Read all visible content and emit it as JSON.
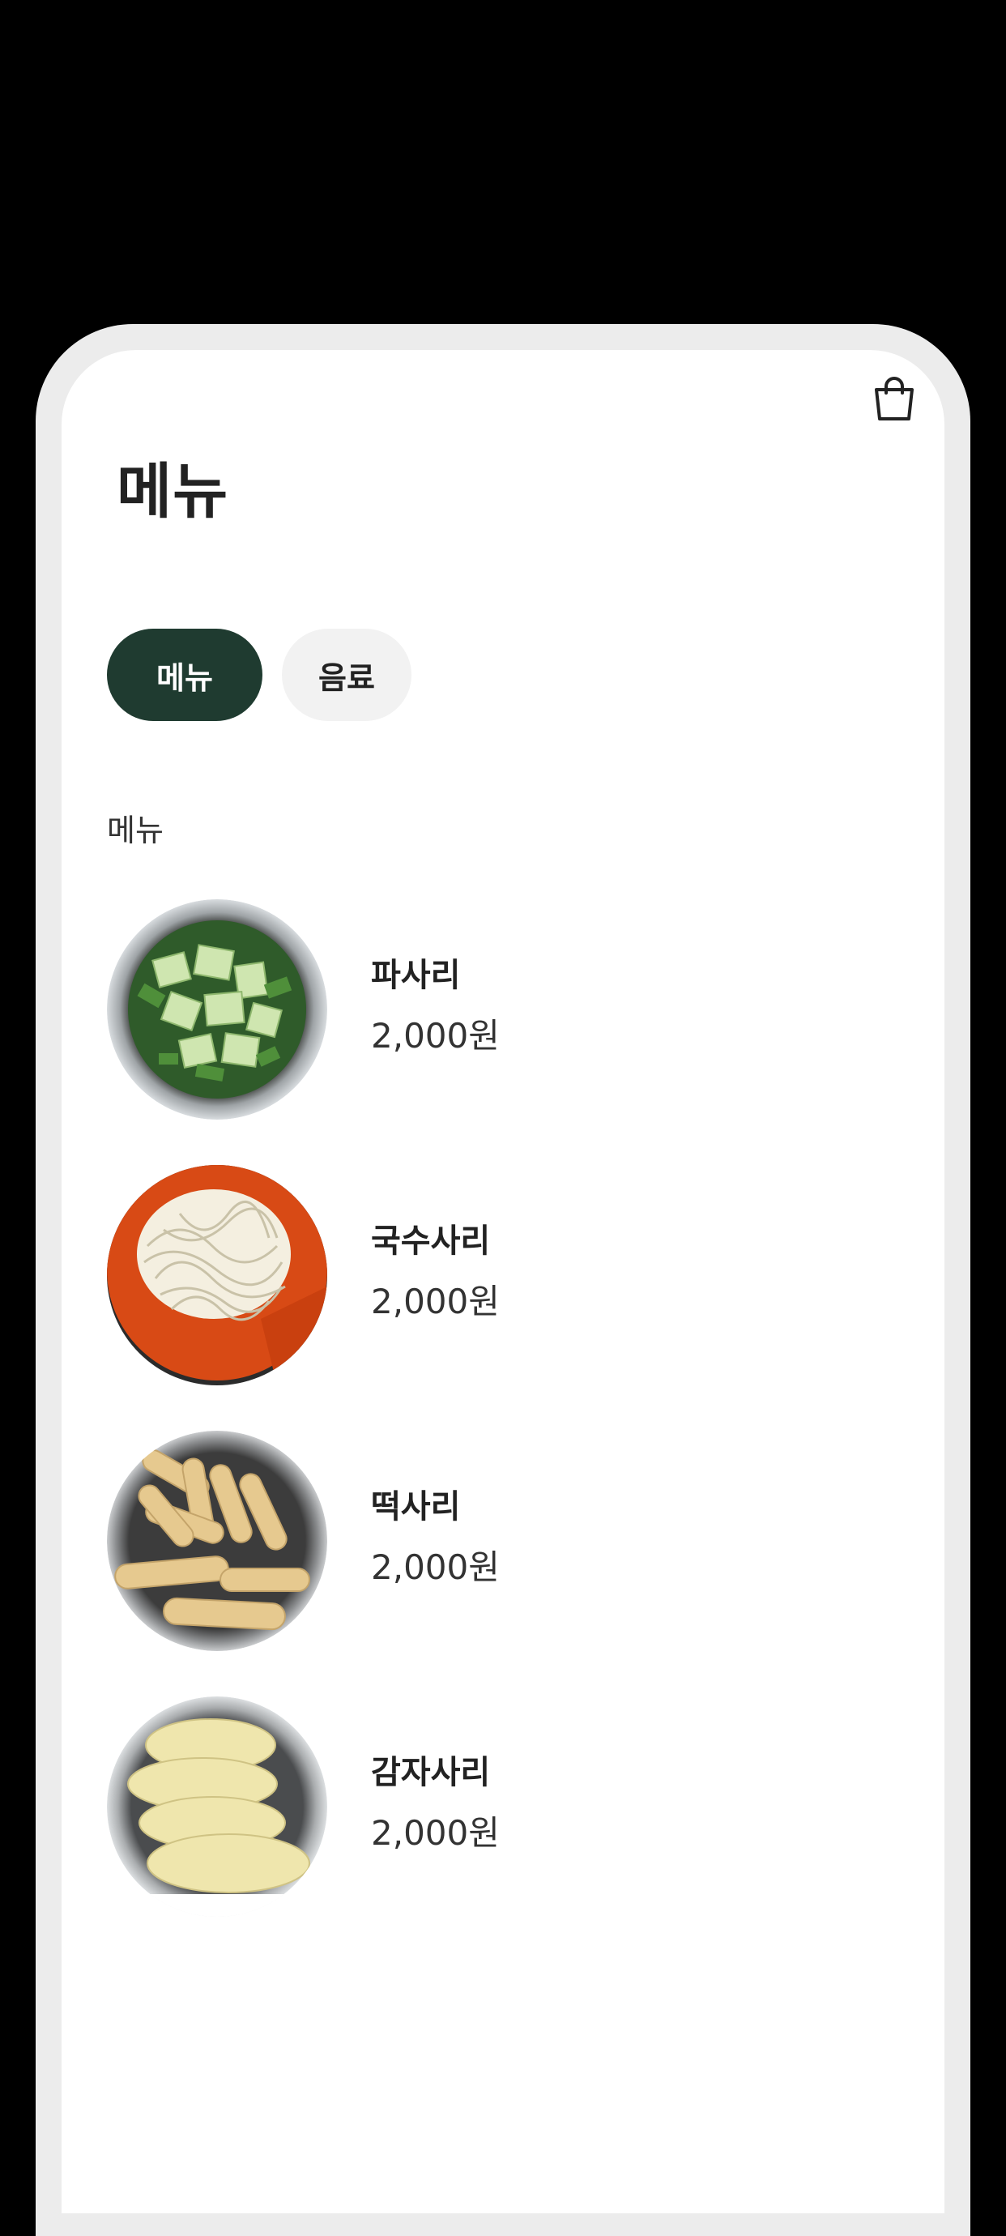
{
  "header": {
    "title": "메뉴",
    "cart_icon": "shopping-bag-icon"
  },
  "tabs": [
    {
      "label": "메뉴",
      "active": true
    },
    {
      "label": "음료",
      "active": false
    }
  ],
  "section": {
    "label": "메뉴"
  },
  "items": [
    {
      "name": "파사리",
      "price": "2,000원",
      "image": "green-onion-photo"
    },
    {
      "name": "국수사리",
      "price": "2,000원",
      "image": "noodles-photo"
    },
    {
      "name": "떡사리",
      "price": "2,000원",
      "image": "rice-cake-photo"
    },
    {
      "name": "감자사리",
      "price": "2,000원",
      "image": "potato-photo"
    }
  ],
  "colors": {
    "accent": "#1f3b30",
    "inactive_tab": "#f2f2f2",
    "frame": "#ececec",
    "background": "#000000"
  }
}
